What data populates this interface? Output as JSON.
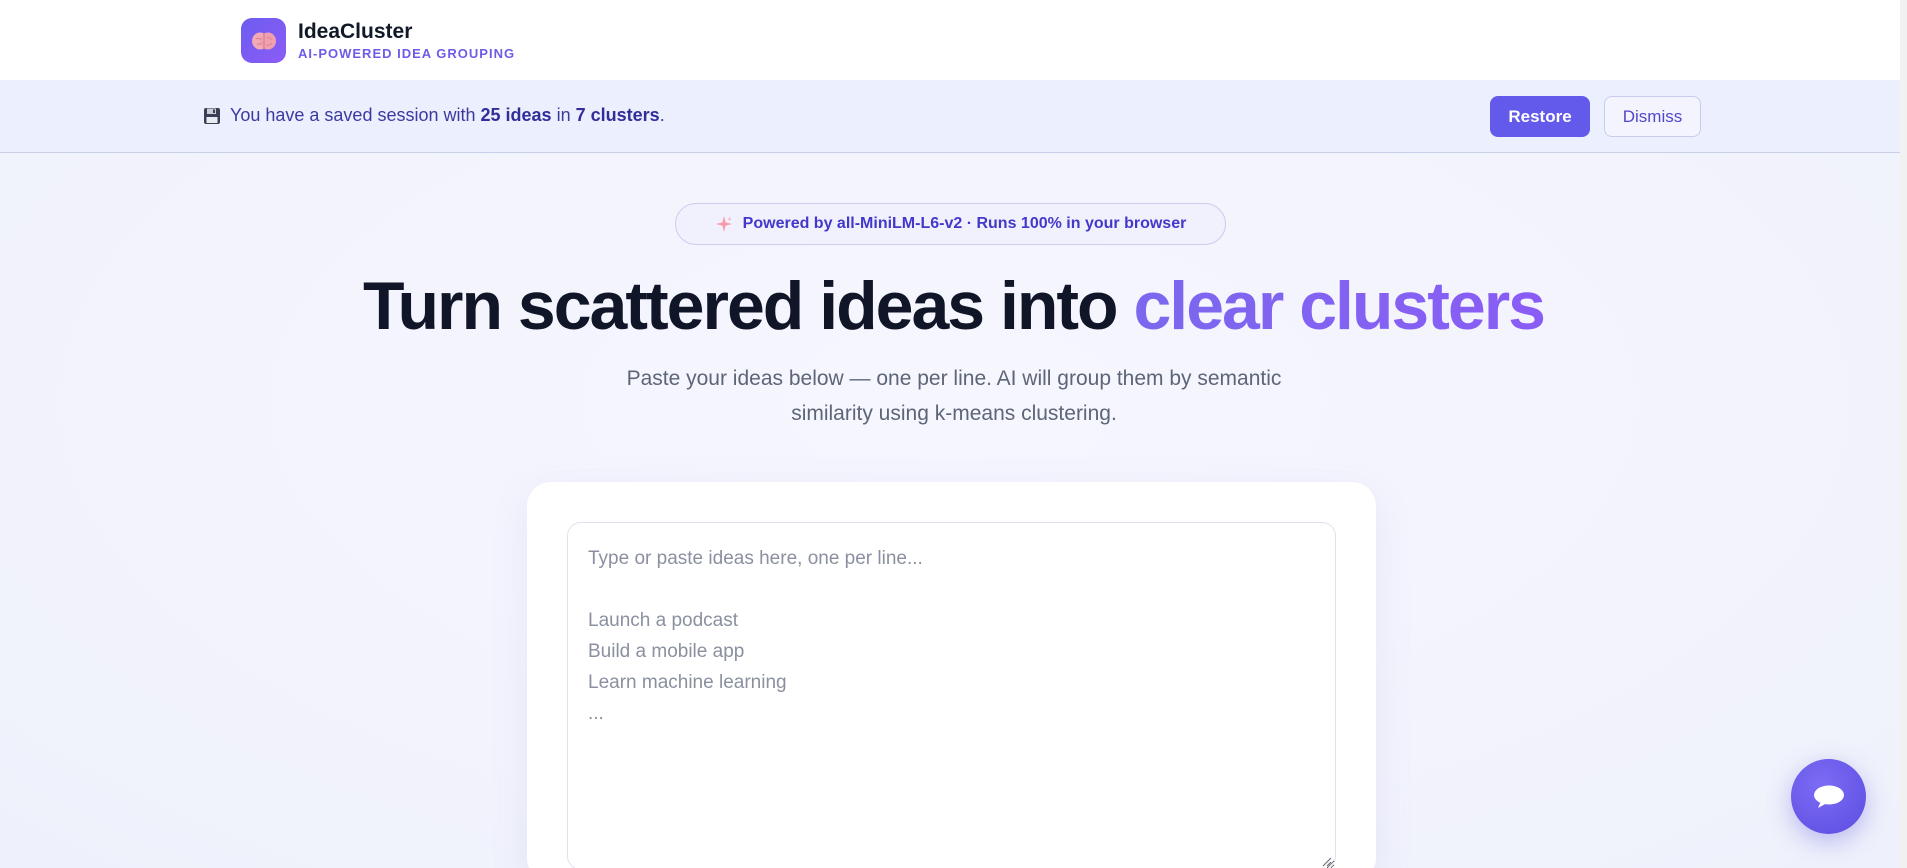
{
  "header": {
    "brand_name": "IdeaCluster",
    "brand_tagline": "AI-POWERED IDEA GROUPING",
    "logo_icon": "brain-icon"
  },
  "banner": {
    "icon": "floppy-disk-icon",
    "text_before": "You have a saved session with ",
    "ideas_count": "25 ideas",
    "text_middle": " in ",
    "clusters_count": "7 clusters",
    "text_after": ".",
    "restore_label": "Restore",
    "dismiss_label": "Dismiss"
  },
  "hero": {
    "pill_icon": "sparkles-icon",
    "pill_text": "Powered by all-MiniLM-L6-v2 · Runs 100% in your browser",
    "headline_main": "Turn scattered ideas into ",
    "headline_accent": "clear clusters",
    "subtitle": "Paste your ideas below — one per line. AI will group them by semantic similarity using k-means clustering."
  },
  "input": {
    "placeholder": "Type or paste ideas here, one per line...\n\nLaunch a podcast\nBuild a mobile app\nLearn machine learning\n...",
    "value": ""
  },
  "chat": {
    "icon": "chat-bubble-icon"
  },
  "colors": {
    "accent": "#6359ea",
    "accent_gradient_end": "#8a5cf6",
    "banner_bg": "#eceffd"
  }
}
